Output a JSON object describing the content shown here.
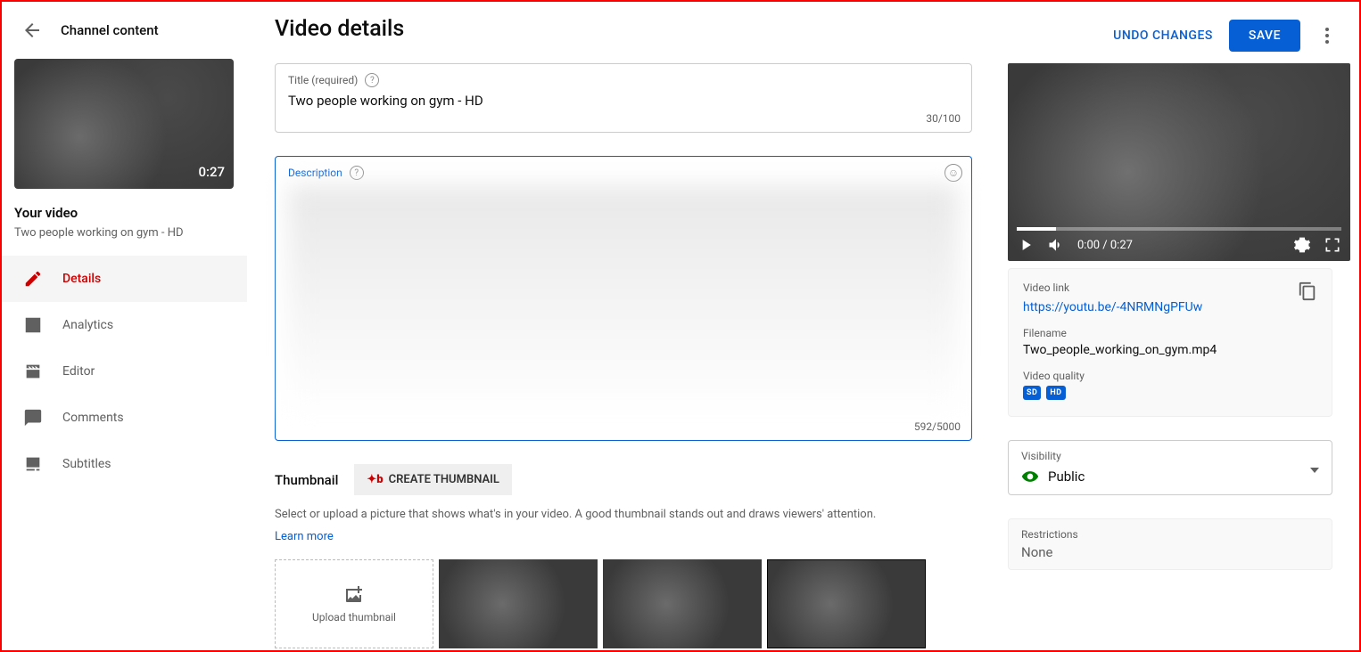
{
  "header": {
    "channel_content": "Channel content",
    "page_title": "Video details",
    "undo": "UNDO CHANGES",
    "save": "SAVE"
  },
  "sidebar": {
    "your_video": "Your video",
    "video_sub": "Two people working on gym - HD",
    "duration": "0:27",
    "items": [
      {
        "icon": "pencil",
        "label": "Details"
      },
      {
        "icon": "bar",
        "label": "Analytics"
      },
      {
        "icon": "clap",
        "label": "Editor"
      },
      {
        "icon": "chat",
        "label": "Comments"
      },
      {
        "icon": "cc",
        "label": "Subtitles"
      }
    ]
  },
  "form": {
    "title_label": "Title (required)",
    "title_value": "Two people working on gym - HD",
    "title_count": "30/100",
    "desc_label": "Description",
    "desc_count": "592/5000",
    "thumbnail_heading": "Thumbnail",
    "create_thumbnail": "CREATE THUMBNAIL",
    "thumbnail_desc": "Select or upload a picture that shows what's in your video. A good thumbnail stands out and draws viewers' attention.",
    "learn_more": "Learn more",
    "upload_thumbnail": "Upload thumbnail"
  },
  "preview": {
    "time": "0:00 / 0:27",
    "video_link_label": "Video link",
    "video_link": "https://youtu.be/-4NRMNgPFUw",
    "filename_label": "Filename",
    "filename": "Two_people_working_on_gym.mp4",
    "quality_label": "Video quality",
    "badges": [
      "SD",
      "HD"
    ]
  },
  "visibility": {
    "label": "Visibility",
    "value": "Public"
  },
  "restrictions": {
    "label": "Restrictions",
    "value": "None"
  }
}
